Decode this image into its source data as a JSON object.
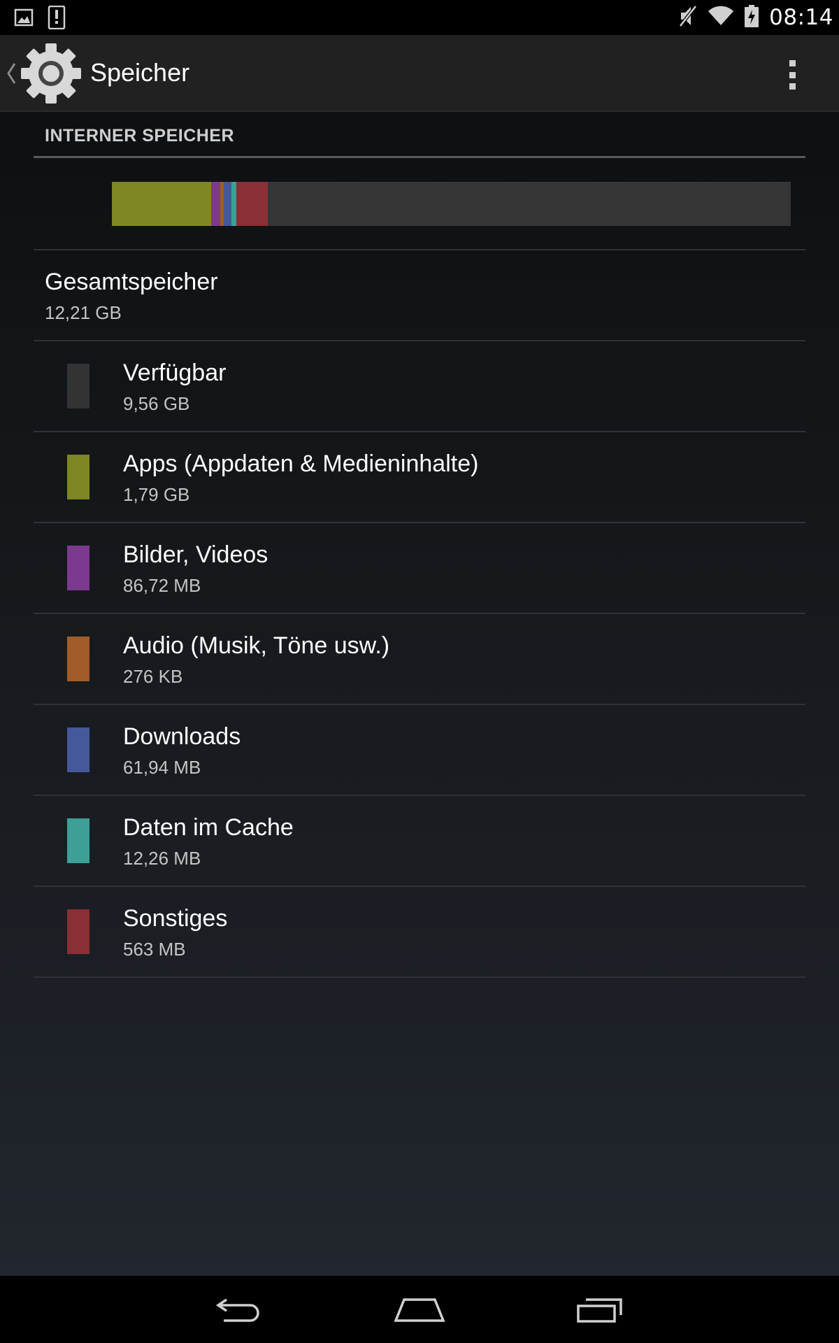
{
  "status_bar": {
    "time": "08:14",
    "left_icons": [
      "image-notification-icon",
      "alert-notification-icon"
    ],
    "right_icons": [
      "mute-icon",
      "wifi-icon",
      "battery-icon"
    ]
  },
  "action_bar": {
    "title": "Speicher",
    "icons": [
      "back-caret-icon",
      "settings-gear-icon",
      "overflow-menu-icon"
    ]
  },
  "section": {
    "header": "INTERNER SPEICHER"
  },
  "usage_bar": {
    "track_color": "#363636",
    "segments": [
      {
        "name": "apps",
        "color": "#7f8624",
        "fraction": 0.1466
      },
      {
        "name": "pictures",
        "color": "#7b3a8e",
        "fraction": 0.0127
      },
      {
        "name": "audio",
        "color": "#a15c2a",
        "fraction": 0.005
      },
      {
        "name": "downloads",
        "color": "#45599a",
        "fraction": 0.0115
      },
      {
        "name": "cache",
        "color": "#3e9f97",
        "fraction": 0.0077
      },
      {
        "name": "other",
        "color": "#8a2f33",
        "fraction": 0.0461
      }
    ]
  },
  "total": {
    "title": "Gesamtspeicher",
    "value": "12,21 GB"
  },
  "categories": [
    {
      "title": "Verfügbar",
      "value": "9,56 GB",
      "color": "#333333"
    },
    {
      "title": "Apps (Appdaten & Medieninhalte)",
      "value": "1,79 GB",
      "color": "#7f8624"
    },
    {
      "title": "Bilder, Videos",
      "value": "86,72 MB",
      "color": "#7b3a8e"
    },
    {
      "title": "Audio (Musik, Töne usw.)",
      "value": "276 KB",
      "color": "#a15c2a"
    },
    {
      "title": "Downloads",
      "value": "61,94 MB",
      "color": "#45599a"
    },
    {
      "title": "Daten im Cache",
      "value": "12,26 MB",
      "color": "#3e9f97"
    },
    {
      "title": "Sonstiges",
      "value": "563 MB",
      "color": "#8a2f33"
    }
  ],
  "nav_bar": {
    "icons": [
      "back-icon",
      "home-icon",
      "recent-apps-icon"
    ]
  }
}
